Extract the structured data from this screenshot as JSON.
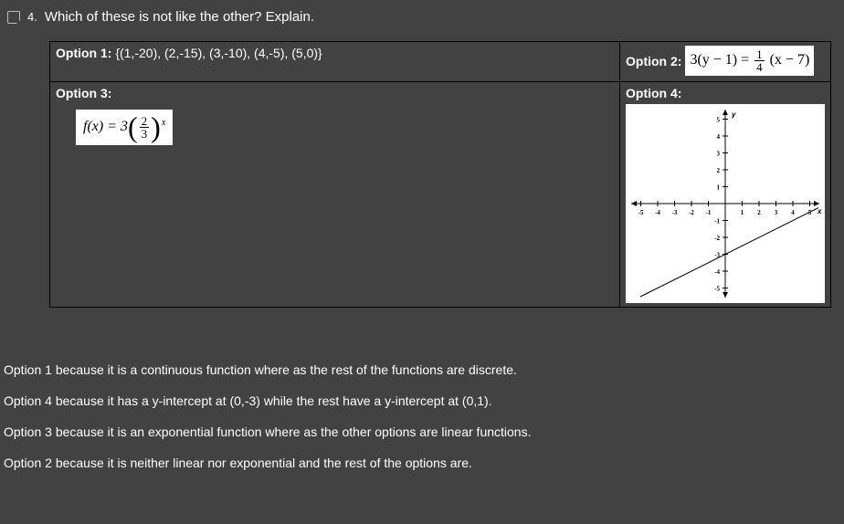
{
  "question": {
    "number": "4.",
    "text": "Which of these is not like the other? Explain."
  },
  "options": {
    "opt1": {
      "label": "Option 1:",
      "value": "{(1,-20), (2,-15), (3,-10), (4,-5), (5,0)}"
    },
    "opt2": {
      "label": "Option 2:",
      "eq_left": "3(y − 1) =",
      "eq_frac_num": "1",
      "eq_frac_den": "4",
      "eq_right": "(x − 7)"
    },
    "opt3": {
      "label": "Option 3:",
      "formula_prefix": "f(x) = 3",
      "frac_num": "2",
      "frac_den": "3",
      "exponent": "x"
    },
    "opt4": {
      "label": "Option 4:"
    }
  },
  "chart_data": {
    "type": "line",
    "title": "",
    "xlabel": "x",
    "ylabel": "y",
    "xlim": [
      -5.5,
      5.5
    ],
    "ylim": [
      -5.5,
      5.5
    ],
    "x_ticks": [
      -5,
      -4,
      -3,
      -2,
      -1,
      1,
      2,
      3,
      4,
      5
    ],
    "y_ticks": [
      -5,
      -4,
      -3,
      -2,
      -1,
      1,
      2,
      3,
      4,
      5
    ],
    "series": [
      {
        "name": "line",
        "points": [
          [
            -5,
            -5.5
          ],
          [
            5.5,
            -0.25
          ]
        ],
        "note": "linear, slope 0.5, y-intercept -3"
      }
    ]
  },
  "answers": {
    "a1": "Option 1 because it is a continuous function where as the rest of the functions are discrete.",
    "a2": "Option 4 because it has a y-intercept at (0,-3) while the rest have a y-intercept at (0,1).",
    "a3": "Option 3 because it is an exponential function where as the other options are linear functions.",
    "a4": "Option 2 because it is neither linear nor exponential and the rest of the options are."
  }
}
